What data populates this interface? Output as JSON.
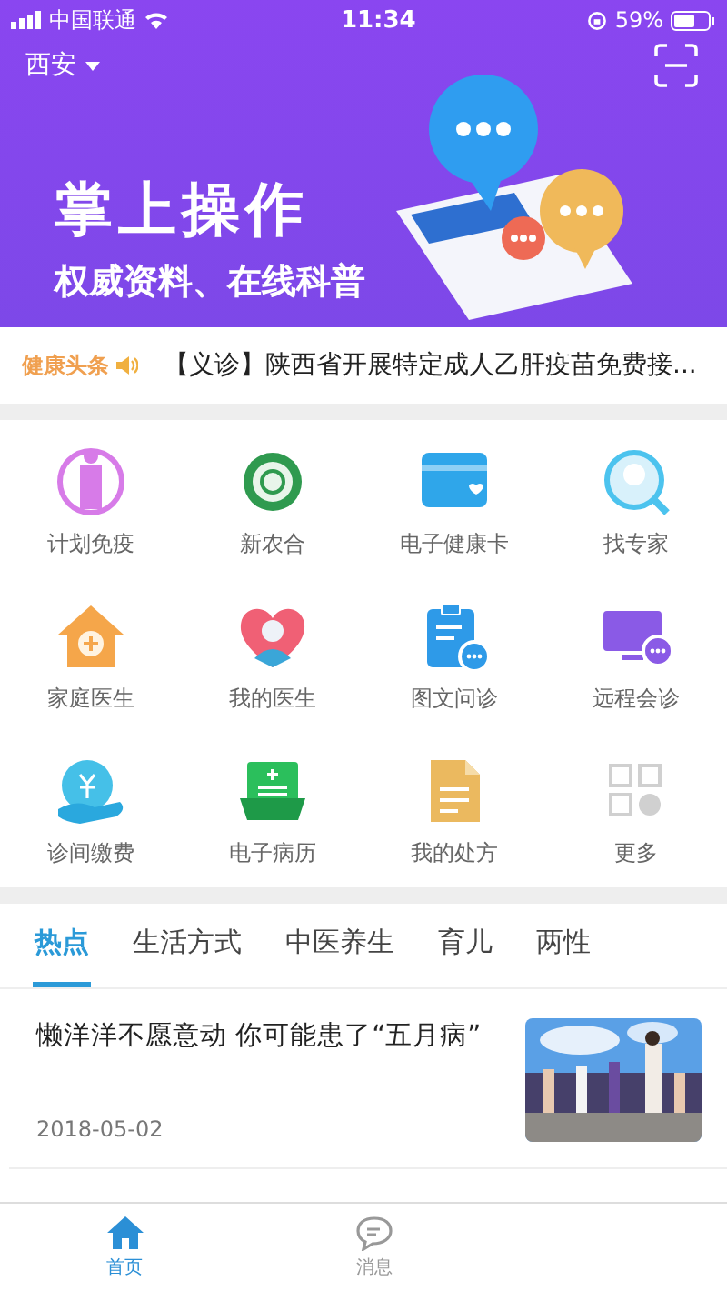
{
  "status_bar": {
    "carrier": "中国联通",
    "time": "11:34",
    "battery": "59%"
  },
  "header": {
    "city": "西安"
  },
  "banner": {
    "title": "掌上操作",
    "subtitle": "权威资料、在线科普"
  },
  "ticker": {
    "label": "健康头条",
    "text": "【义诊】陕西省开展特定成人乙肝疫苗免费接..."
  },
  "services": [
    {
      "kind": "vaccine",
      "label": "计划免疫"
    },
    {
      "kind": "coop",
      "label": "新农合"
    },
    {
      "kind": "card",
      "label": "电子健康卡"
    },
    {
      "kind": "expert",
      "label": "找专家"
    },
    {
      "kind": "home",
      "label": "家庭医生"
    },
    {
      "kind": "heart",
      "label": "我的医生"
    },
    {
      "kind": "clipboard",
      "label": "图文问诊"
    },
    {
      "kind": "monitor",
      "label": "远程会诊"
    },
    {
      "kind": "pay",
      "label": "诊间缴费"
    },
    {
      "kind": "record",
      "label": "电子病历"
    },
    {
      "kind": "doc",
      "label": "我的处方"
    },
    {
      "kind": "more",
      "label": "更多"
    }
  ],
  "tabs": [
    {
      "label": "热点",
      "selected": true
    },
    {
      "label": "生活方式",
      "selected": false
    },
    {
      "label": "中医养生",
      "selected": false
    },
    {
      "label": "育儿",
      "selected": false
    },
    {
      "label": "两性",
      "selected": false
    }
  ],
  "articles": [
    {
      "title": "懒洋洋不愿意动 你可能患了“五月病”",
      "date": "2018-05-02"
    }
  ],
  "tab_bar": [
    {
      "kind": "home",
      "label": "首页",
      "selected": true
    },
    {
      "kind": "message",
      "label": "消息",
      "selected": false
    }
  ]
}
